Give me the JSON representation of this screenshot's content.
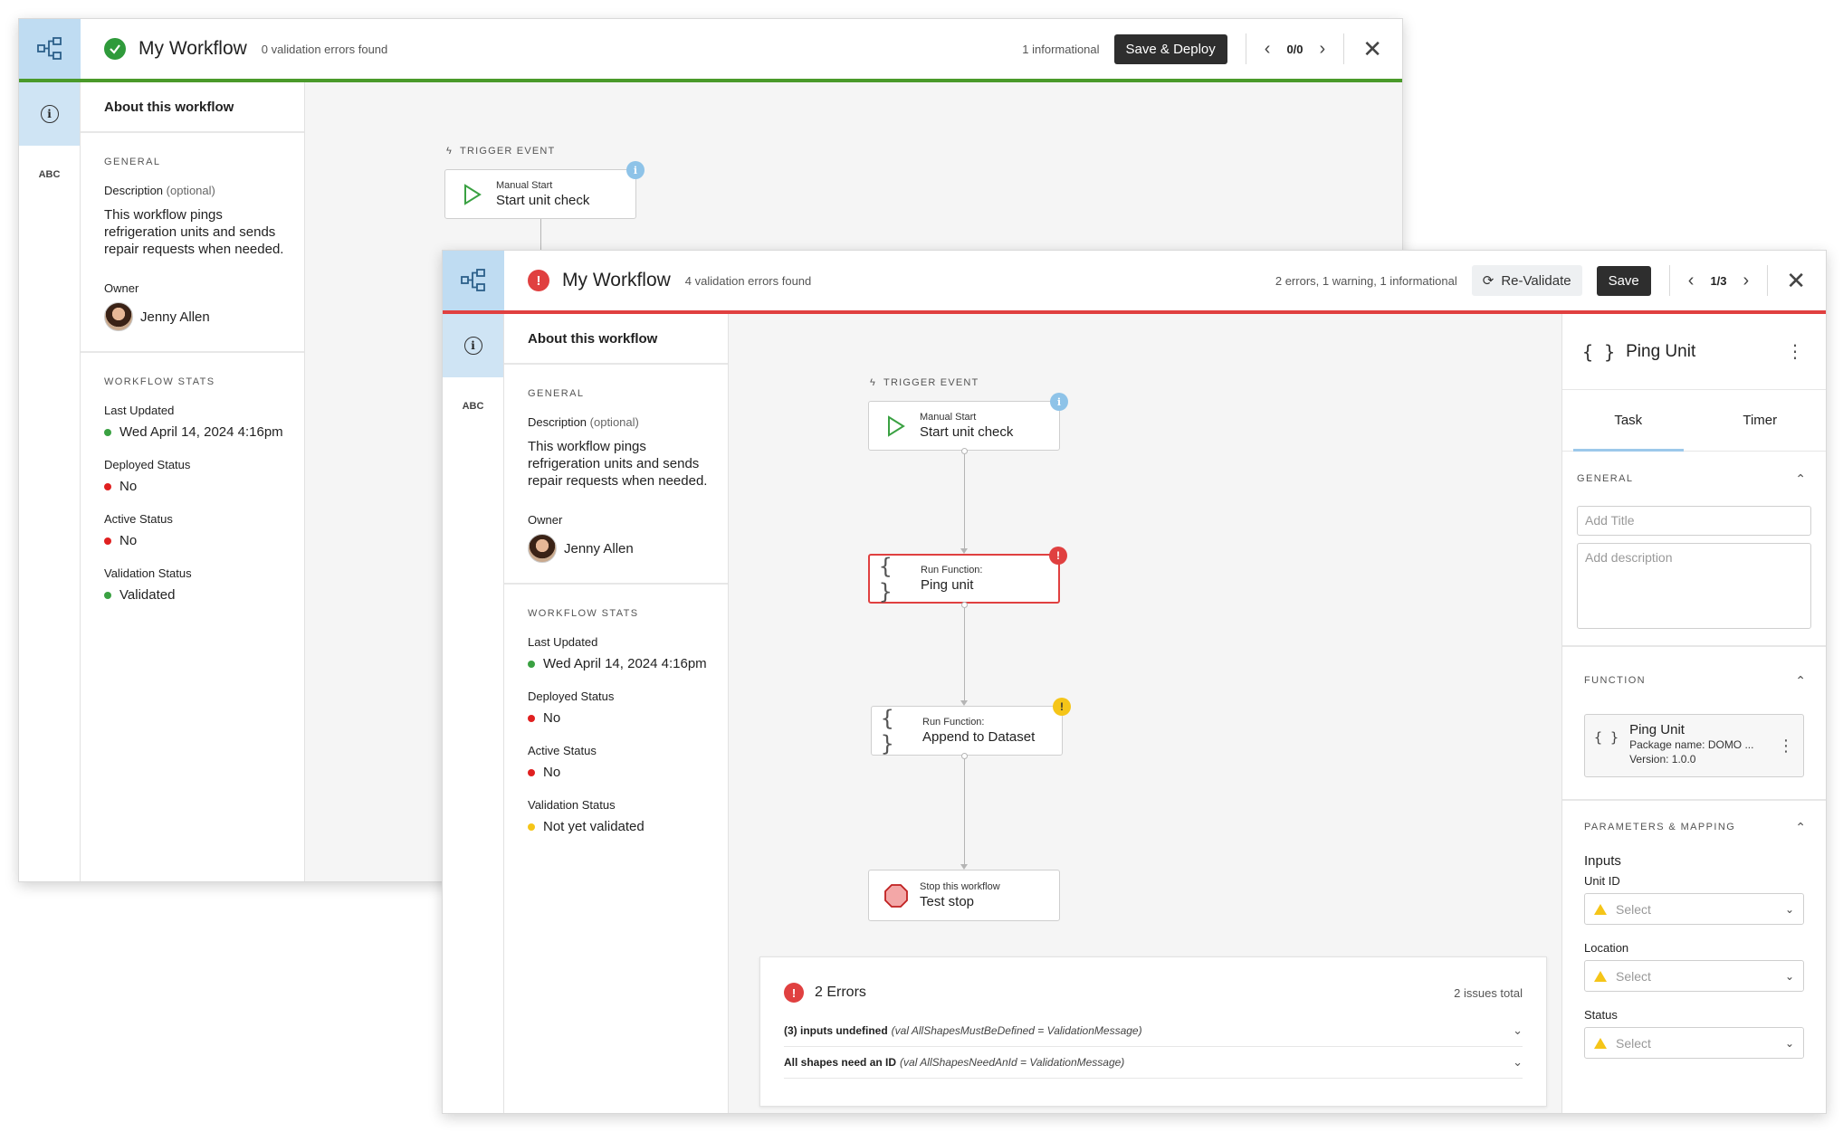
{
  "back_window": {
    "title": "My Workflow",
    "validation_summary": "0 validation errors found",
    "info_count": "1 informational",
    "deploy_label": "Save & Deploy",
    "pager": "0/0",
    "sidebar": {
      "heading": "About this workflow",
      "general_label": "GENERAL",
      "description_label": "Description",
      "optional_label": "(optional)",
      "description": "This workflow pings refrigeration units and sends repair requests when needed.",
      "owner_label": "Owner",
      "owner": "Jenny Allen",
      "stats_label": "WORKFLOW STATS",
      "stats": [
        {
          "label": "Last Updated",
          "value": "Wed April 14, 2024 4:16pm",
          "color": "#3aa142"
        },
        {
          "label": "Deployed Status",
          "value": "No",
          "color": "#e02020"
        },
        {
          "label": "Active Status",
          "value": "No",
          "color": "#e02020"
        },
        {
          "label": "Validation Status",
          "value": "Validated",
          "color": "#3aa142"
        }
      ]
    },
    "trigger_label": "TRIGGER EVENT",
    "trigger_node": {
      "type": "Manual Start",
      "name": "Start unit check"
    }
  },
  "front_window": {
    "title": "My Workflow",
    "validation_summary": "4 validation errors found",
    "issue_summary": "2 errors, 1 warning, 1 informational",
    "revalidate_label": "Re-Validate",
    "save_label": "Save",
    "pager": "1/3",
    "sidebar": {
      "heading": "About this workflow",
      "general_label": "GENERAL",
      "description_label": "Description",
      "optional_label": "(optional)",
      "description": "This workflow pings refrigeration units and sends repair requests when needed.",
      "owner_label": "Owner",
      "owner": "Jenny Allen",
      "stats_label": "WORKFLOW STATS",
      "stats": [
        {
          "label": "Last Updated",
          "value": "Wed April 14, 2024 4:16pm",
          "color": "#3aa142"
        },
        {
          "label": "Deployed Status",
          "value": "No",
          "color": "#e02020"
        },
        {
          "label": "Active Status",
          "value": "No",
          "color": "#e02020"
        },
        {
          "label": "Validation Status",
          "value": "Not yet validated",
          "color": "#f5c518"
        }
      ]
    },
    "trigger_label": "TRIGGER EVENT",
    "nodes": [
      {
        "type": "Manual Start",
        "name": "Start unit check",
        "status": "info"
      },
      {
        "type": "Run Function:",
        "name": "Ping unit",
        "status": "error"
      },
      {
        "type": "Run Function:",
        "name": "Append to Dataset",
        "status": "warning"
      },
      {
        "type": "Stop this workflow",
        "name": "Test stop",
        "status": "none"
      }
    ],
    "errors_panel": {
      "title": "2 Errors",
      "total": "2 issues total",
      "rows": [
        {
          "message": "(3) inputs undefined",
          "detail": "(val AllShapesMustBeDefined = ValidationMessage)"
        },
        {
          "message": "All shapes need an ID",
          "detail": "(val AllShapesNeedAnId = ValidationMessage)"
        }
      ]
    },
    "right_panel": {
      "title": "Ping Unit",
      "tabs": [
        "Task",
        "Timer"
      ],
      "active_tab": "Task",
      "general_label": "GENERAL",
      "title_placeholder": "Add Title",
      "description_placeholder": "Add description",
      "function_label": "FUNCTION",
      "function_card": {
        "name": "Ping Unit",
        "package": "Package name: DOMO ...",
        "version": "Version: 1.0.0"
      },
      "params_label": "PARAMETERS & MAPPING",
      "inputs_label": "Inputs",
      "fields": [
        {
          "label": "Unit ID",
          "placeholder": "Select"
        },
        {
          "label": "Location",
          "placeholder": "Select"
        },
        {
          "label": "Status",
          "placeholder": "Select"
        }
      ]
    }
  }
}
